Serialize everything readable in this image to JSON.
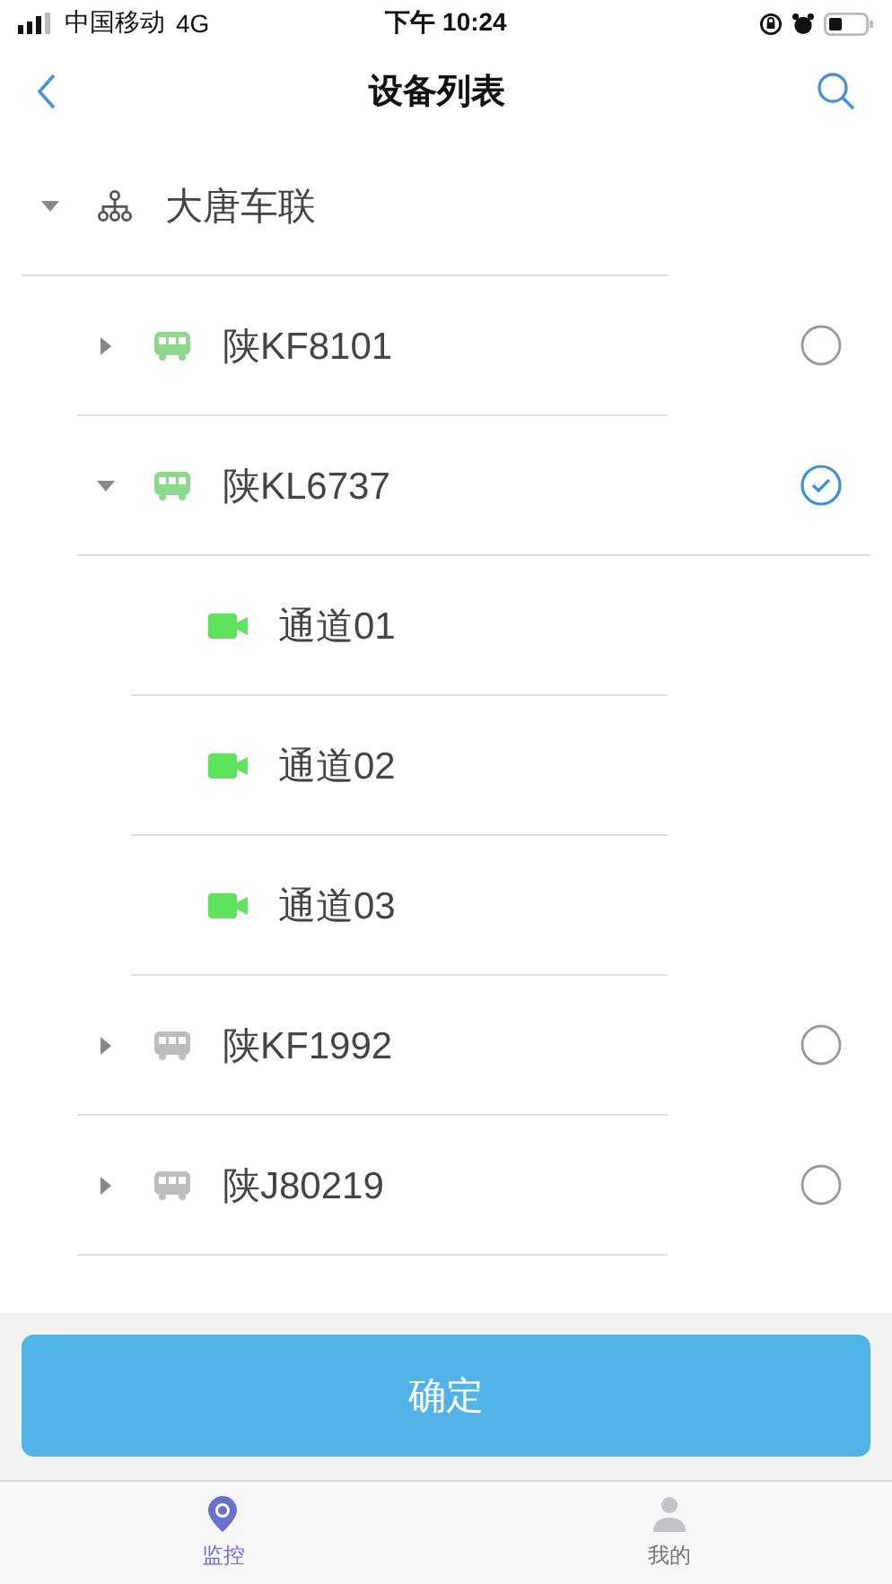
{
  "status_bar": {
    "carrier": "中国移动",
    "network": "4G",
    "time": "下午 10:24"
  },
  "nav": {
    "title": "设备列表"
  },
  "tree": {
    "label": "大唐车联",
    "expanded": true,
    "children": [
      {
        "label": "陕KF8101",
        "online": true,
        "expanded": false,
        "checked": false
      },
      {
        "label": "陕KL6737",
        "online": true,
        "expanded": true,
        "checked": true,
        "children": [
          {
            "label": "通道01"
          },
          {
            "label": "通道02"
          },
          {
            "label": "通道03"
          }
        ]
      },
      {
        "label": "陕KF1992",
        "online": false,
        "expanded": false,
        "checked": false
      },
      {
        "label": "陕J80219",
        "online": false,
        "expanded": false,
        "checked": false
      }
    ]
  },
  "confirm_button": "确定",
  "tab_bar": [
    {
      "label": "监控",
      "kind": "monitor",
      "selected": true
    },
    {
      "label": "我的",
      "kind": "profile",
      "selected": false
    }
  ]
}
